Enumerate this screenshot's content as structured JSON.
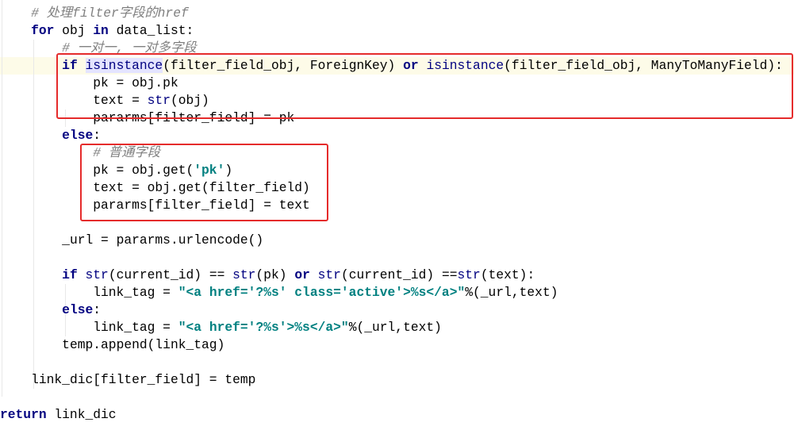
{
  "code": {
    "lines": [
      {
        "indent": "    ",
        "parts": [
          {
            "t": "# 处理filter字段的href",
            "c": "cm"
          }
        ]
      },
      {
        "indent": "    ",
        "parts": [
          {
            "t": "for",
            "c": "kw"
          },
          {
            "t": " obj "
          },
          {
            "t": "in",
            "c": "kw"
          },
          {
            "t": " data_list:"
          }
        ]
      },
      {
        "indent": "        ",
        "parts": [
          {
            "t": "# 一对一, 一对多字段",
            "c": "cm"
          }
        ]
      },
      {
        "indent": "        ",
        "parts": [
          {
            "t": "if",
            "c": "kw"
          },
          {
            "t": " "
          },
          {
            "t": "isinstance",
            "c": "bi sel"
          },
          {
            "t": "(filter_field_obj, ForeignKey) "
          },
          {
            "t": "or",
            "c": "kw"
          },
          {
            "t": " "
          },
          {
            "t": "isinstance",
            "c": "bi"
          },
          {
            "t": "(filter_field_obj, ManyToManyField):"
          }
        ]
      },
      {
        "indent": "            ",
        "parts": [
          {
            "t": "pk = obj.pk"
          }
        ]
      },
      {
        "indent": "            ",
        "parts": [
          {
            "t": "text = "
          },
          {
            "t": "str",
            "c": "bi"
          },
          {
            "t": "(obj)"
          }
        ]
      },
      {
        "indent": "            ",
        "parts": [
          {
            "t": "pararms[filter_field] = pk"
          }
        ]
      },
      {
        "indent": "        ",
        "parts": [
          {
            "t": "else",
            "c": "kw"
          },
          {
            "t": ":"
          }
        ]
      },
      {
        "indent": "            ",
        "parts": [
          {
            "t": "# 普通字段",
            "c": "cm"
          }
        ]
      },
      {
        "indent": "            ",
        "parts": [
          {
            "t": "pk = obj.get("
          },
          {
            "t": "'pk'",
            "c": "str"
          },
          {
            "t": ")"
          }
        ]
      },
      {
        "indent": "            ",
        "parts": [
          {
            "t": "text = obj.get(filter_field)"
          }
        ]
      },
      {
        "indent": "            ",
        "parts": [
          {
            "t": "pararms[filter_field] = text"
          }
        ]
      },
      {
        "indent": "",
        "parts": []
      },
      {
        "indent": "        ",
        "parts": [
          {
            "t": "_url = pararms.urlencode()"
          }
        ]
      },
      {
        "indent": "",
        "parts": []
      },
      {
        "indent": "        ",
        "parts": [
          {
            "t": "if",
            "c": "kw"
          },
          {
            "t": " "
          },
          {
            "t": "str",
            "c": "bi"
          },
          {
            "t": "(current_id) == "
          },
          {
            "t": "str",
            "c": "bi"
          },
          {
            "t": "(pk) "
          },
          {
            "t": "or",
            "c": "kw"
          },
          {
            "t": " "
          },
          {
            "t": "str",
            "c": "bi"
          },
          {
            "t": "(current_id) =="
          },
          {
            "t": "str",
            "c": "bi"
          },
          {
            "t": "(text):"
          }
        ]
      },
      {
        "indent": "            ",
        "parts": [
          {
            "t": "link_tag = "
          },
          {
            "t": "\"<a href='?%s' class='active'>%s</a>\"",
            "c": "str"
          },
          {
            "t": "%(_url,text)"
          }
        ]
      },
      {
        "indent": "        ",
        "parts": [
          {
            "t": "else",
            "c": "kw"
          },
          {
            "t": ":"
          }
        ]
      },
      {
        "indent": "            ",
        "parts": [
          {
            "t": "link_tag = "
          },
          {
            "t": "\"<a href='?%s'>%s</a>\"",
            "c": "str"
          },
          {
            "t": "%(_url,text)"
          }
        ]
      },
      {
        "indent": "        ",
        "parts": [
          {
            "t": "temp.append(link_tag)"
          }
        ]
      },
      {
        "indent": "",
        "parts": []
      },
      {
        "indent": "    ",
        "parts": [
          {
            "t": "link_dic[filter_field] = temp"
          }
        ]
      },
      {
        "indent": "",
        "parts": []
      },
      {
        "indent": "",
        "parts": [
          {
            "t": "return",
            "c": "kw"
          },
          {
            "t": " link_dic"
          }
        ]
      }
    ]
  },
  "annotations": {
    "color": "#e52b2b"
  }
}
